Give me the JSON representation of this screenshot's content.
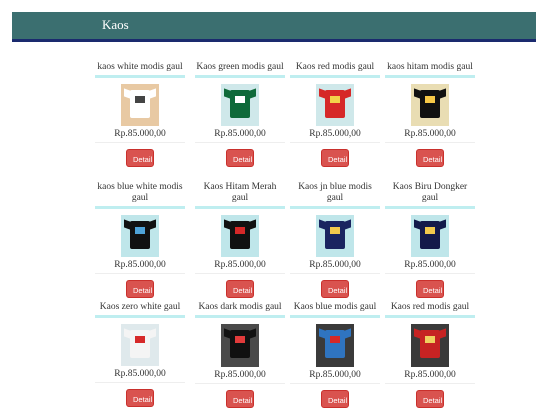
{
  "header": {
    "title": "Kaos"
  },
  "detail_label": "Detail",
  "products": [
    {
      "name": "kaos white modis gaul",
      "price": "Rp.85.000,00",
      "tee": "#ffffff",
      "bg": "#e8c9a3",
      "print": "#444444",
      "dark": false
    },
    {
      "name": "Kaos green modis gaul",
      "price": "Rp.85.000,00",
      "tee": "#0f6a3a",
      "bg": "#cfe8ea",
      "print": "#ffffff",
      "dark": false
    },
    {
      "name": "Kaos red modis gaul",
      "price": "Rp.85.000,00",
      "tee": "#d62828",
      "bg": "#cfe8ea",
      "print": "#f3d34a",
      "dark": false
    },
    {
      "name": "kaos hitam modis gaul",
      "price": "Rp.85.000,00",
      "tee": "#111111",
      "bg": "#e9ddb3",
      "print": "#f7c948",
      "dark": false
    },
    {
      "name": "kaos blue white modis gaul",
      "price": "Rp.85.000,00",
      "tee": "#111111",
      "bg": "#bfe6ea",
      "print": "#4fa3d8",
      "dark": false
    },
    {
      "name": "Kaos Hitam Merah gaul",
      "price": "Rp.85.000,00",
      "tee": "#111111",
      "bg": "#bfe6ea",
      "print": "#d62828",
      "dark": false
    },
    {
      "name": "Kaos jn blue modis gaul",
      "price": "Rp.85.000,00",
      "tee": "#1a2460",
      "bg": "#bfe6ea",
      "print": "#f2c94c",
      "dark": false
    },
    {
      "name": "Kaos Biru Dongker gaul",
      "price": "Rp.85.000,00",
      "tee": "#141a4a",
      "bg": "#bfe6ea",
      "print": "#f2c94c",
      "dark": false
    },
    {
      "name": "Kaos zero white gaul",
      "price": "Rp.85.000,00",
      "tee": "#f4f4f4",
      "bg": "#dfe9ec",
      "print": "#d62828",
      "dark": false
    },
    {
      "name": "Kaos dark modis gaul",
      "price": "Rp.85.000,00",
      "tee": "#111111",
      "bg": "#4a4a4a",
      "print": "#e23b3b",
      "dark": true
    },
    {
      "name": "Kaos blue modis gaul",
      "price": "Rp.85.000,00",
      "tee": "#2f74c0",
      "bg": "#3a3a3a",
      "print": "#d62828",
      "dark": true
    },
    {
      "name": "Kaos red modis gaul",
      "price": "Rp.85.000,00",
      "tee": "#c62323",
      "bg": "#3a3a3a",
      "print": "#f0d060",
      "dark": true
    }
  ]
}
